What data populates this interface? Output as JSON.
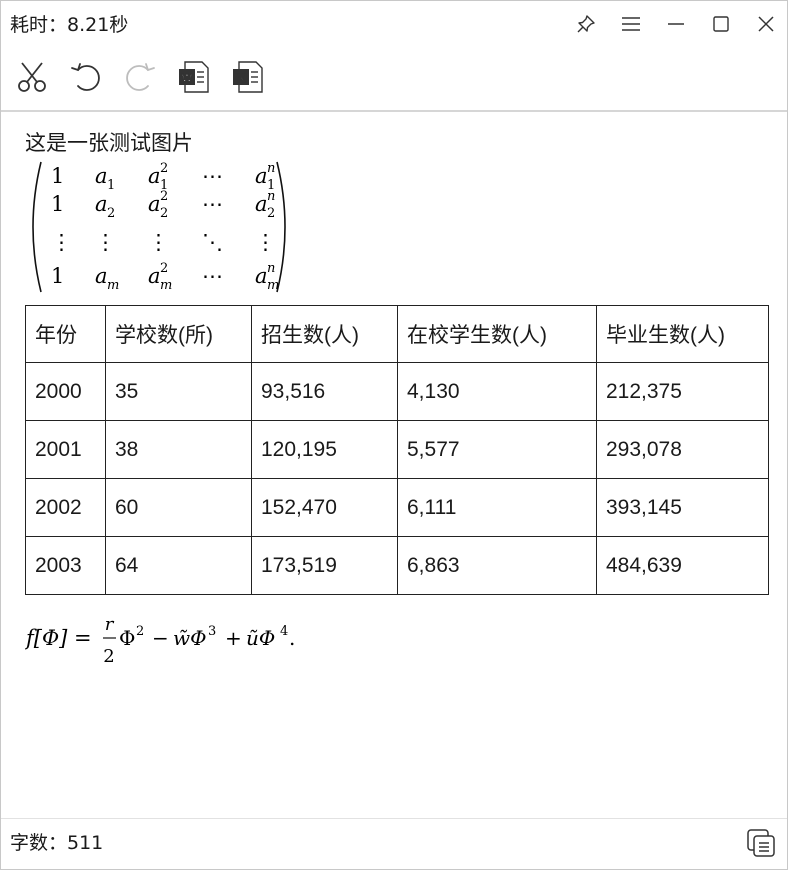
{
  "titlebar": {
    "title": "耗时：8.21秒",
    "icons": [
      "pin-icon",
      "menu-icon",
      "minimize-icon",
      "maximize-icon",
      "close-icon"
    ]
  },
  "toolbar": {
    "icons": [
      "scissors-icon",
      "undo-icon",
      "redo-icon",
      "word-export-icon",
      "excel-export-icon"
    ]
  },
  "content": {
    "heading": "这是一张测试图片",
    "matrix": {
      "rows": [
        [
          "1",
          "a",
          "a",
          "⋯",
          "a"
        ],
        [
          "1",
          "a",
          "a",
          "⋯",
          "a"
        ],
        [
          "⋮",
          "⋮",
          "⋮",
          "⋱",
          "⋮"
        ],
        [
          "1",
          "a",
          "a",
          "⋯",
          "a"
        ]
      ],
      "subscripts": [
        [
          "",
          "1",
          "1",
          "",
          "1"
        ],
        [
          "",
          "2",
          "2",
          "",
          "2"
        ],
        [
          "",
          "",
          "",
          "",
          ""
        ],
        [
          "",
          "m",
          "m",
          "",
          "m"
        ]
      ],
      "superscripts": [
        [
          "",
          "",
          "2",
          "",
          "n"
        ],
        [
          "",
          "",
          "2",
          "",
          "n"
        ],
        [
          "",
          "",
          "",
          "",
          ""
        ],
        [
          "",
          "",
          "2",
          "",
          "n"
        ]
      ]
    },
    "table": {
      "headers": [
        "年份",
        "学校数(所)",
        "招生数(人)",
        "在校学生数(人)",
        "毕业生数(人)"
      ],
      "rows": [
        [
          "2000",
          "35",
          "93,516",
          "4,130",
          "212,375"
        ],
        [
          "2001",
          "38",
          "120,195",
          "5,577",
          "293,078"
        ],
        [
          "2002",
          "60",
          "152,470",
          "6,111",
          "393,145"
        ],
        [
          "2003",
          "64",
          "173,519",
          "6,863",
          "484,639"
        ]
      ]
    },
    "formula": {
      "lhs": "f[Φ] =",
      "frac_num": "r",
      "frac_den": "2",
      "t1": "Φ",
      "t1_exp": "2",
      "minus": "−",
      "t2": "w̃Φ",
      "t2_exp": "3",
      "plus": "+",
      "t3": "ũΦ",
      "t3_exp": "4",
      "end": "."
    }
  },
  "status": {
    "word_count": "字数：511",
    "copy_icon": "copy-icon"
  }
}
